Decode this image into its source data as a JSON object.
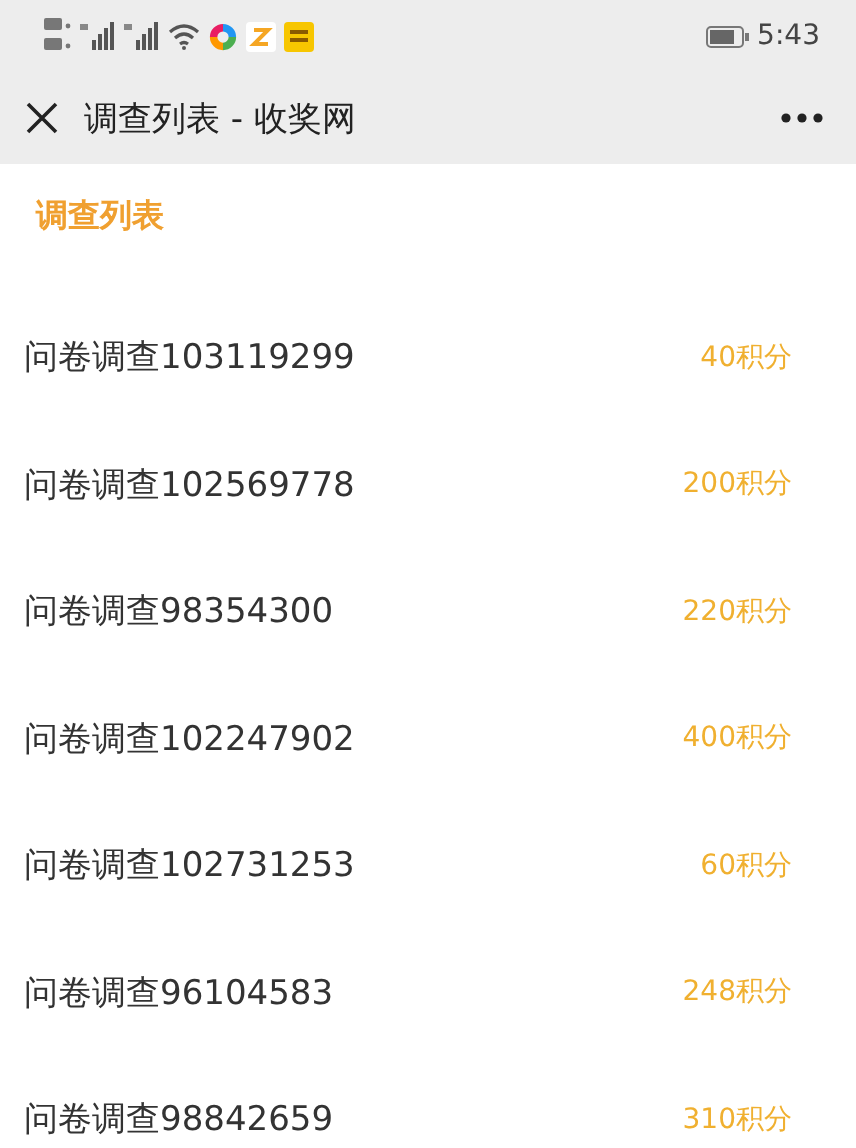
{
  "status_bar": {
    "time": "5:43"
  },
  "nav_bar": {
    "title": "调查列表 - 收奖网"
  },
  "section": {
    "title": "调查列表"
  },
  "surveys": [
    {
      "name": "问卷调查103119299",
      "points": "40积分"
    },
    {
      "name": "问卷调查102569778",
      "points": "200积分"
    },
    {
      "name": "问卷调查98354300",
      "points": "220积分"
    },
    {
      "name": "问卷调查102247902",
      "points": "400积分"
    },
    {
      "name": "问卷调查102731253",
      "points": "60积分"
    },
    {
      "name": "问卷调查96104583",
      "points": "248积分"
    },
    {
      "name": "问卷调查98842659",
      "points": "310积分"
    }
  ]
}
